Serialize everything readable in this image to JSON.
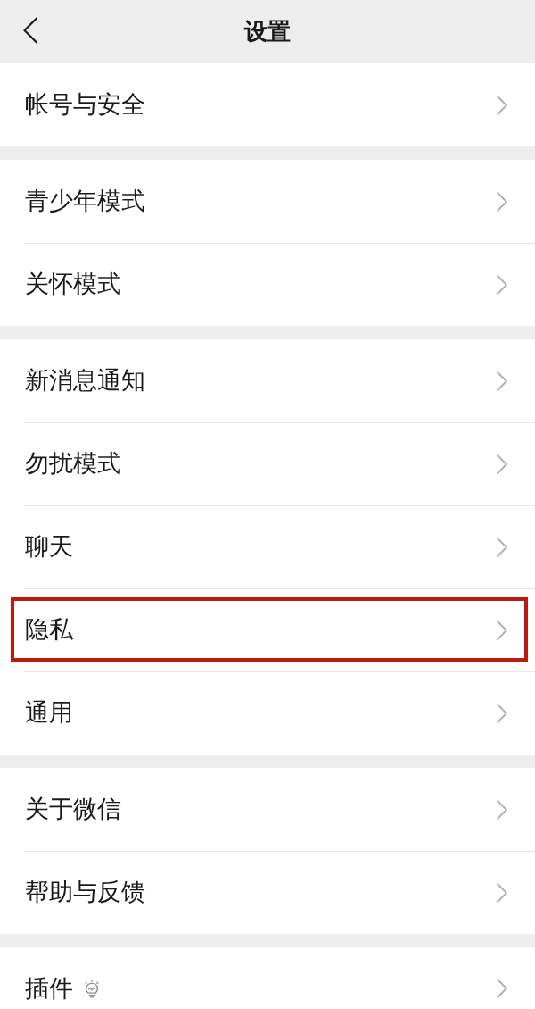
{
  "header": {
    "title": "设置"
  },
  "groups": [
    {
      "items": [
        {
          "label": "帐号与安全",
          "kind": "plain",
          "highlighted": false
        }
      ]
    },
    {
      "items": [
        {
          "label": "青少年模式",
          "kind": "plain",
          "highlighted": false
        },
        {
          "label": "关怀模式",
          "kind": "plain",
          "highlighted": false
        }
      ]
    },
    {
      "items": [
        {
          "label": "新消息通知",
          "kind": "plain",
          "highlighted": false
        },
        {
          "label": "勿扰模式",
          "kind": "plain",
          "highlighted": false
        },
        {
          "label": "聊天",
          "kind": "plain",
          "highlighted": false
        },
        {
          "label": "隐私",
          "kind": "plain",
          "highlighted": true
        },
        {
          "label": "通用",
          "kind": "plain",
          "highlighted": false
        }
      ]
    },
    {
      "items": [
        {
          "label": "关于微信",
          "kind": "plain",
          "highlighted": false
        },
        {
          "label": "帮助与反馈",
          "kind": "plain",
          "highlighted": false
        }
      ]
    },
    {
      "items": [
        {
          "label": "插件",
          "kind": "with-icon",
          "highlighted": false
        }
      ]
    }
  ]
}
